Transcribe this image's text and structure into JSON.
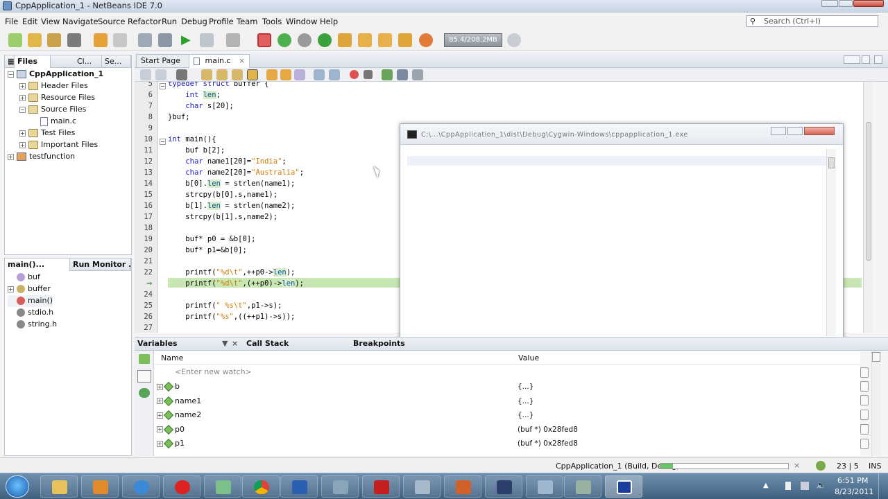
{
  "window": {
    "title": "CppApplication_1 - NetBeans IDE 7.0"
  },
  "menu": [
    "File",
    "Edit",
    "View",
    "Navigate",
    "Source",
    "Refactor",
    "Run",
    "Debug",
    "Profile",
    "Team",
    "Tools",
    "Window",
    "Help"
  ],
  "search": {
    "placeholder": "Search (Ctrl+I)"
  },
  "toolbar": {
    "memory": "85.4/208.2MB"
  },
  "projects_panel": {
    "tabs": [
      "Files",
      "Cl...",
      "Se..."
    ],
    "tree": [
      {
        "label": "CppApplication_1",
        "level": 0,
        "type": "project",
        "expander": "−"
      },
      {
        "label": "Header Files",
        "level": 1,
        "type": "folder",
        "expander": "+"
      },
      {
        "label": "Resource Files",
        "level": 1,
        "type": "folder",
        "expander": "+"
      },
      {
        "label": "Source Files",
        "level": 1,
        "type": "folder",
        "expander": "−"
      },
      {
        "label": "main.c",
        "level": 2,
        "type": "file",
        "expander": ""
      },
      {
        "label": "Test Files",
        "level": 1,
        "type": "folder",
        "expander": "+"
      },
      {
        "label": "Important Files",
        "level": 1,
        "type": "folder",
        "expander": "+"
      },
      {
        "label": "testfunction",
        "level": 0,
        "type": "project2",
        "expander": "+"
      }
    ]
  },
  "navigator_panel": {
    "tabs": [
      "main()...",
      "Run Monitor ..."
    ],
    "items": [
      {
        "label": "buf",
        "expander": ""
      },
      {
        "label": "buffer",
        "expander": "+"
      },
      {
        "label": "main()",
        "expander": ""
      },
      {
        "label": "stdio.h",
        "expander": ""
      },
      {
        "label": "string.h",
        "expander": ""
      }
    ]
  },
  "editor": {
    "tabs": [
      "Start Page",
      "main.c"
    ],
    "lines": [
      {
        "n": "5",
        "text": "typedef struct buffer {"
      },
      {
        "n": "6",
        "text": "    int len;"
      },
      {
        "n": "7",
        "text": "    char s[20];"
      },
      {
        "n": "8",
        "text": "}buf;"
      },
      {
        "n": "9",
        "text": ""
      },
      {
        "n": "10",
        "text": "int main(){"
      },
      {
        "n": "11",
        "text": "    buf b[2];"
      },
      {
        "n": "12",
        "text": "    char name1[20]=\"India\";"
      },
      {
        "n": "13",
        "text": "    char name2[20]=\"Australia\";"
      },
      {
        "n": "14",
        "text": "    b[0].len = strlen(name1);"
      },
      {
        "n": "15",
        "text": "    strcpy(b[0].s,name1);"
      },
      {
        "n": "16",
        "text": "    b[1].len = strlen(name2);"
      },
      {
        "n": "17",
        "text": "    strcpy(b[1].s,name2);"
      },
      {
        "n": "18",
        "text": ""
      },
      {
        "n": "19",
        "text": "    buf* p0 = &b[0];"
      },
      {
        "n": "20",
        "text": "    buf* p1=&b[0];"
      },
      {
        "n": "21",
        "text": ""
      },
      {
        "n": "22",
        "text": "    printf(\"%d\\t\",++p0->len);"
      },
      {
        "n": "",
        "text": "    printf(\"%d\\t\",(++p0)->len);"
      },
      {
        "n": "24",
        "text": ""
      },
      {
        "n": "25",
        "text": "    printf(\" %s\\t\",p1->s);"
      },
      {
        "n": "26",
        "text": "    printf(\"%s\",((++p1)->s));"
      },
      {
        "n": "27",
        "text": ""
      }
    ]
  },
  "console": {
    "title": "C:\\...\\CppApplication_1\\dist\\Debug\\Cygwin-Windows\\cppapplication_1.exe"
  },
  "bottom_panel": {
    "tabs": [
      "Variables",
      "Call Stack",
      "Breakpoints"
    ],
    "columns": {
      "name": "Name",
      "value": "Value"
    },
    "new_watch": "<Enter new watch>",
    "rows": [
      {
        "name": "b",
        "value": "{...}"
      },
      {
        "name": "name1",
        "value": "{...}"
      },
      {
        "name": "name2",
        "value": "{...}"
      },
      {
        "name": "p0",
        "value": "(buf *) 0x28fed8"
      },
      {
        "name": "p1",
        "value": "(buf *) 0x28fed8"
      }
    ]
  },
  "status": {
    "build": "CppApplication_1 (Build, Debug)",
    "position": "23 | 5",
    "mode": "INS",
    "build_progress": 0.1
  },
  "taskbar": {
    "time": "6:51 PM",
    "date": "8/23/2011"
  }
}
